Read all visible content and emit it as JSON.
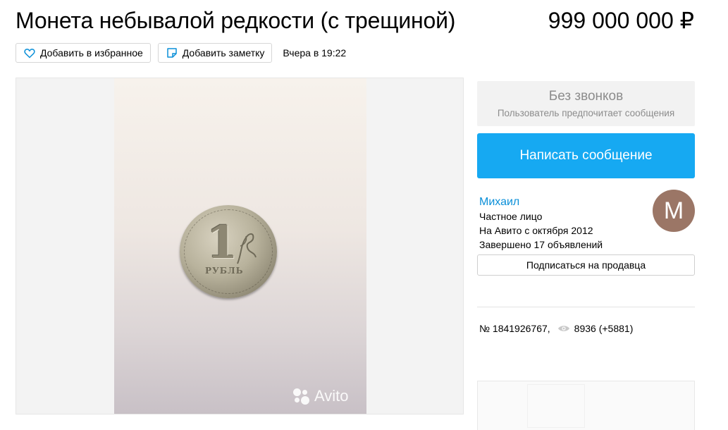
{
  "listing": {
    "title": "Монета небывалой редкости (с трещиной)",
    "price": "999 000 000 ₽",
    "favorite_label": "Добавить в избранное",
    "note_label": "Добавить заметку",
    "posted": "Вчера в 19:22"
  },
  "photo": {
    "watermark": "Avito",
    "coin_denomination": "1",
    "coin_word": "РУБЛЬ"
  },
  "contact": {
    "no_calls_title": "Без звонков",
    "no_calls_sub": "Пользователь предпочитает сообщения",
    "write_label": "Написать сообщение"
  },
  "seller": {
    "name": "Михаил",
    "type": "Частное лицо",
    "since": "На Авито с октября 2012",
    "completed": "Завершено 17 объявлений",
    "avatar_letter": "M",
    "subscribe_label": "Подписаться на продавца"
  },
  "meta": {
    "ad_number": "№ 1841926767,",
    "views": "8936 (+5881)"
  },
  "colors": {
    "accent": "#16a9f2",
    "link": "#0a8fd8",
    "avatar_bg": "#9b7666"
  },
  "icons": [
    "heart-icon",
    "note-icon",
    "eye-icon",
    "avito-logo-icon"
  ]
}
